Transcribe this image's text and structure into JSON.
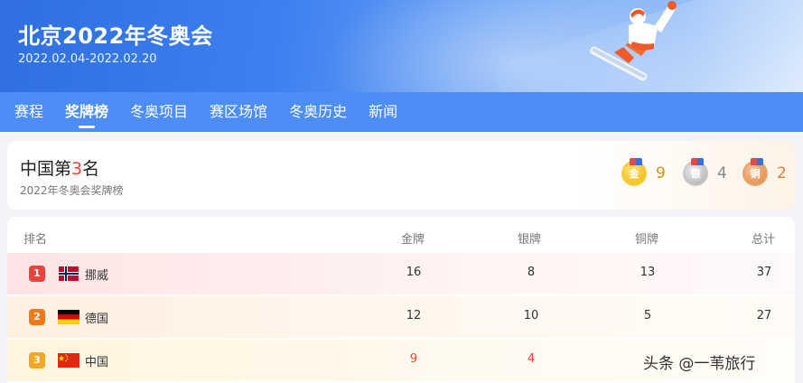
{
  "banner": {
    "title": "北京2022年冬奥会",
    "dates": "2022.02.04-2022.02.20"
  },
  "nav": {
    "tabs": [
      {
        "label": "赛程",
        "active": false
      },
      {
        "label": "奖牌榜",
        "active": true
      },
      {
        "label": "冬奥项目",
        "active": false
      },
      {
        "label": "赛区场馆",
        "active": false
      },
      {
        "label": "冬奥历史",
        "active": false
      },
      {
        "label": "新闻",
        "active": false
      }
    ]
  },
  "summary": {
    "title_prefix": "中国第",
    "rank": "3",
    "title_suffix": "名",
    "subtitle": "2022年冬奥会奖牌榜",
    "gold_icon_text": "金",
    "silver_icon_text": "银",
    "bronze_icon_text": "铜",
    "gold": "9",
    "silver": "4",
    "bronze": "2"
  },
  "table": {
    "headers": {
      "rank": "排名",
      "gold": "金牌",
      "silver": "银牌",
      "bronze": "铜牌",
      "total": "总计"
    },
    "rows": [
      {
        "rank": "1",
        "country": "挪威",
        "flag": "norway-flag-icon",
        "gold": "16",
        "silver": "8",
        "bronze": "13",
        "total": "37"
      },
      {
        "rank": "2",
        "country": "德国",
        "flag": "germany-flag-icon",
        "gold": "12",
        "silver": "10",
        "bronze": "5",
        "total": "27"
      },
      {
        "rank": "3",
        "country": "中国",
        "flag": "china-flag-icon",
        "gold": "9",
        "silver": "4",
        "bronze": "",
        "total": ""
      }
    ]
  },
  "watermark": "头条 @一苇旅行",
  "colors": {
    "nav_bg": "#4c8ef5",
    "banner_start": "#2f6fe0",
    "accent_red": "#e9443b",
    "gold": "#c9961b",
    "bronze": "#d9823f"
  }
}
